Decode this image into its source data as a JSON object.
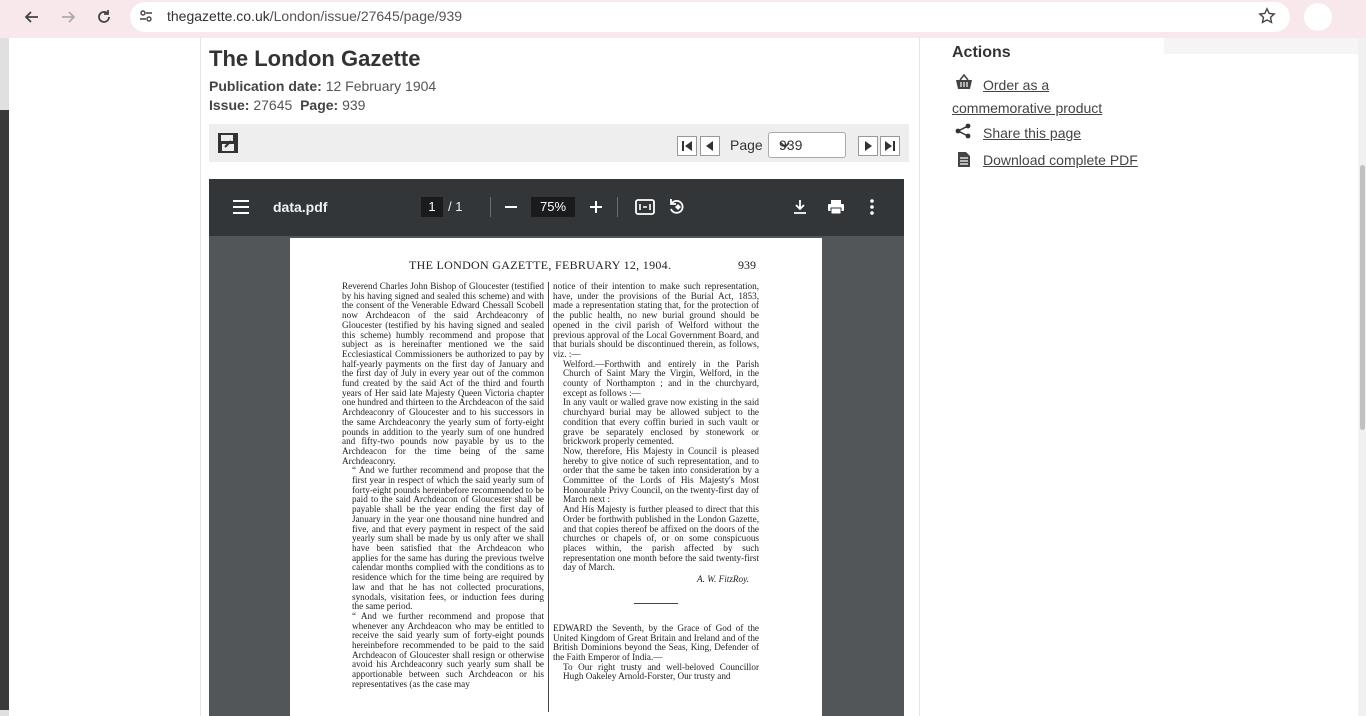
{
  "browser": {
    "url_domain": "thegazette.co.uk",
    "url_path": "/London/issue/27645/page/939"
  },
  "gazette": {
    "title": "The London Gazette",
    "publication_label": "Publication date:",
    "publication_date": "12 February 1904",
    "issue_label": "Issue:",
    "issue": "27645",
    "page_label": "Page:",
    "page": "939"
  },
  "pager": {
    "label": "Page",
    "selected": "939"
  },
  "pdf": {
    "filename": "data.pdf",
    "current_page": "1",
    "page_count": "/ 1",
    "zoom": "75%",
    "header": "THE LONDON GAZETTE, FEBRUARY 12, 1904.",
    "page_number": "939",
    "left_column": [
      "Reverend Charles John Bishop of Gloucester (testified by his having signed and sealed this scheme) and with the consent of the Venerable Edward Chessall Scobell now Archdeacon of the said Archdeaconry of Gloucester (testified by his having signed and sealed this scheme) humbly recommend and propose that subject as is hereinafter mentioned we the said Ecclesiastical Commissioners be authorized to pay by half-yearly payments on the first day of January and the first day of July in every year out of the common fund created by the said Act of the third and fourth years of Her said late Majesty Queen Victoria chapter one hundred and thirteen to the Archdeacon of the said Archdeaconry of Gloucester and to his successors in the same Archdeaconry the yearly sum of forty-eight pounds in addition to the yearly sum of one hundred and fifty-two pounds now payable by us to the Archdeacon for the time being of the same Archdeaconry.",
      "“ And we further recommend and propose that the first year in respect of which the said yearly sum of forty-eight pounds hereinbefore recommended to be paid to the said Archdeacon of Gloucester shall be payable shall be the year ending the first day of January in the year one thousand nine hundred and five, and that every payment in respect of the said yearly sum shall be made by us only after we shall have been satisfied that the Archdeacon who applies for the same has during the previous twelve calendar months complied with the conditions as to residence which for the time being are required by law and that he has not collected procurations, synodals, visitation fees, or induction fees during the same period.",
      "“ And we further recommend and propose that whenever any Archdeacon who may be entitled to receive the said yearly sum of forty-eight pounds hereinbefore recommended to be paid to the said Archdeacon of Gloucester shall resign or otherwise avoid his Archdeaconry such yearly sum shall be apportionable between such Archdeacon or his representatives (as the case may"
    ],
    "right_column": [
      "notice of their intention to make such representation, have, under the provisions of the Burial Act, 1853, made a representation stating that, for the protection of the public health, no new burial ground should be opened in the civil parish of Welford without the previous approval of the Local Government Board, and that burials should be discontinued therein, as follows, viz. :—",
      "Welford.—Forthwith and entirely in the Parish Church of Saint Mary the Virgin, Welford, in the county of Northampton ; and in the churchyard, except as follows :—",
      "In any vault or walled grave now existing in the said churchyard burial may be allowed subject to the condition that every coffin buried in such vault or grave be separately enclosed by stonework or brickwork properly cemented.",
      "Now, therefore, His Majesty in Council is pleased hereby to give notice of such representation, and to order that the same be taken into consideration by a Committee of the Lords of His Majesty's Most Honourable Privy Council, on the twenty-first day of March next :",
      "And His Majesty is further pleased to direct that this Order be forthwith published in the London Gazette, and that copies thereof be affixed on the doors of the churches or chapels of, or on some conspicuous places within, the parish affected by such representation one month before the said twenty-first day of March.",
      "A. W. FitzRoy.",
      "EDWARD the Seventh, by the Grace of God of the United Kingdom of Great Britain and Ireland and of the British Dominions beyond the Seas, King, Defender of the Faith Emperor of India.—",
      "To Our right trusty and well-beloved Councillor Hugh Oakeley Arnold-Forster, Our trusty and"
    ]
  },
  "sidebar": {
    "title": "Actions",
    "order_label": "Order as a commemorative product",
    "share_label": "Share this page",
    "download_label": "Download complete PDF"
  }
}
